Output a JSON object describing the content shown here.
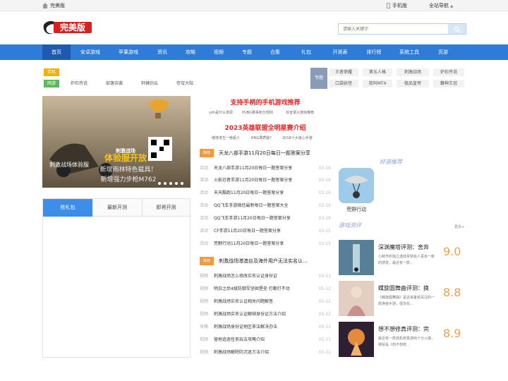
{
  "topbar": {
    "home_label": "完美版",
    "mobile_label": "手机版",
    "sitenav_label": "全站导航"
  },
  "logo": {
    "text": "完美版"
  },
  "search": {
    "placeholder": "请输入关键字"
  },
  "nav": {
    "items": [
      "首页",
      "安卓游戏",
      "苹果游戏",
      "资讯",
      "攻略",
      "视频",
      "专题",
      "合集",
      "礼包",
      "开测表",
      "排行榜",
      "系统工具",
      "页游"
    ]
  },
  "tags": {
    "row1_label": "手机",
    "row2_label": "网游",
    "row2_items": [
      "炉石传说",
      "部落突袭",
      "轩辕剑云",
      "苍穹大陆"
    ]
  },
  "zhuanti": {
    "label": "专题",
    "items": [
      "王者荣耀",
      "第五人格",
      "刺激战场",
      "炉石传说",
      "口袋妖怪",
      "我叫MT4",
      "极品皇帝",
      "鞭神王冠"
    ]
  },
  "banner": {
    "caption": "刺激战场体验服",
    "overlay1": "体验服开放",
    "overlay2": "新增雨林特色载具！",
    "overlay3": "新增强力步枪M762",
    "overlay4": "刺激战场"
  },
  "tabs": {
    "items": [
      "抢礼包",
      "最新开测",
      "即将开测"
    ]
  },
  "headline": {
    "title1": "支持手柄的手机游戏推荐",
    "sub1": [
      "yxh是什么意思",
      "PUBG赛事积分规则",
      "抖音很火游戏推荐"
    ],
    "title2": "2023英雄联盟全明星赛介绍",
    "sub2": [
      "绝地求生一枪超人",
      "RNG遭质疑?",
      "2018十大良心手游"
    ]
  },
  "sec1": {
    "badge": "推荐",
    "title": "天龙八部手游11月20日每日一题答案分享",
    "rows": [
      {
        "c": "活动",
        "t": "天龙八部手游11月20日每日一题答案分享",
        "d": "03-16"
      },
      {
        "c": "活动",
        "t": "火影忍者手游11月20日每日一题答案分享",
        "d": "03-16"
      },
      {
        "c": "活动",
        "t": "天天酷跑11月20日每日一题答案分享",
        "d": "03-16"
      },
      {
        "c": "活动",
        "t": "QQ飞车手游微信最新每日一题答案大全",
        "d": "03-16"
      },
      {
        "c": "活动",
        "t": "QQ飞车手游11月20日每日一题答案分享",
        "d": "03-16"
      },
      {
        "c": "活动",
        "t": "CF手游11月20日每日一题答案分享",
        "d": "03-15"
      },
      {
        "c": "活动",
        "t": "荒野行动11月20日每日一题答案分享",
        "d": "03-15"
      }
    ]
  },
  "sec2": {
    "badge": "推荐",
    "title": "刺激战场港澳台及海外用户无法实名认...",
    "rows": [
      {
        "c": "视频",
        "t": "刺激战场怎么修改实名认证身份证",
        "d": "05-12"
      },
      {
        "c": "视频",
        "t": "明日之后4级防御军坚固堡垒 打都打不动",
        "d": "05-12"
      },
      {
        "c": "视频",
        "t": "刺激战场实名认证相关问题解答",
        "d": "05-12"
      },
      {
        "c": "视频",
        "t": "刺激战场实名认证解绑身份证方法介绍",
        "d": "05-12"
      },
      {
        "c": "攻略",
        "t": "刺激战场身份证地区非法解决办法",
        "d": "05-12"
      },
      {
        "c": "视频",
        "t": "营地追逐任务玩法攻略介绍",
        "d": "05-11"
      },
      {
        "c": "视频",
        "t": "刺激战场解除防沉迷方法介绍",
        "d": "05-11"
      }
    ]
  },
  "right": {
    "hot_title": "好游推荐",
    "hot_game": "荒野行动",
    "rev_title": "游戏测评",
    "more": "更多+",
    "reviews": [
      {
        "title": "深渊魔塔评测：舍弃",
        "desc": "小制作的独立游戏常常给人耳目一新的感觉，最近有一款...",
        "score": "9.0"
      },
      {
        "title": "蝶旋圆舞曲评测：换",
        "desc": "《蝶旋圆舞曲》是近来备受关注的一款换装手游，很多玩...",
        "score": "8.8"
      },
      {
        "title": "想不想修真评测：完",
        "desc": "最近有一款挂机修真游戏十分火爆，那就是《想不想修...",
        "score": "8.9"
      }
    ]
  },
  "colors": {
    "nav_bg": "#2e7cd8",
    "nav_active": "#1e5bb0",
    "headline": "#ee2222",
    "score": "#e7a44a",
    "badge": "#f39a3a"
  }
}
